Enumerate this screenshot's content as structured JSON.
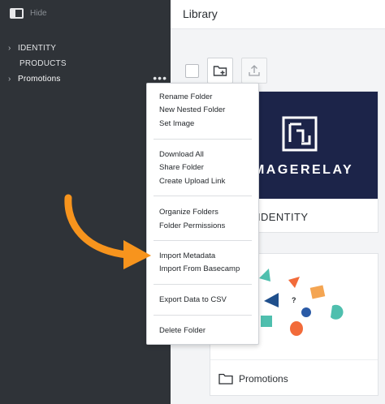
{
  "sidebar": {
    "hide_label": "Hide",
    "items": [
      {
        "label": "IDENTITY",
        "expandable": true
      },
      {
        "label": "PRODUCTS",
        "expandable": false
      },
      {
        "label": "Promotions",
        "expandable": true
      }
    ],
    "more_label": "•••"
  },
  "main": {
    "title": "Library",
    "cards": [
      {
        "label": "IDENTITY",
        "brand": "IMAGERELAY"
      },
      {
        "label": "Promotions"
      }
    ]
  },
  "context_menu": {
    "groups": [
      [
        "Rename Folder",
        "New Nested Folder",
        "Set Image"
      ],
      [
        "Download All",
        "Share Folder",
        "Create Upload Link"
      ],
      [
        "Organize Folders",
        "Folder Permissions"
      ],
      [
        "Import Metadata",
        "Import From Basecamp"
      ],
      [
        "Export Data to CSV"
      ],
      [
        "Delete Folder"
      ]
    ]
  },
  "colors": {
    "sidebar_bg": "#2f3338",
    "brand_navy": "#1c2449",
    "arrow_orange": "#f7941d"
  },
  "icons": [
    "sidebar-toggle-icon",
    "chevron-right-icon",
    "more-icon",
    "new-folder-icon",
    "upload-icon",
    "folder-icon",
    "arrow-annotation"
  ]
}
